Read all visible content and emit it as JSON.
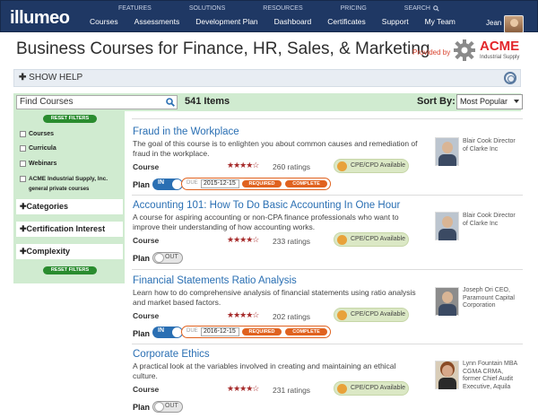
{
  "brand": {
    "logo": "illumeo",
    "accent": "#1f3864"
  },
  "utility_nav": [
    "FEATURES",
    "SOLUTIONS",
    "RESOURCES",
    "PRICING",
    "SEARCH"
  ],
  "main_nav": [
    "Courses",
    "Assessments",
    "Development Plan",
    "Dashboard",
    "Certificates",
    "Support",
    "My Team"
  ],
  "user": {
    "name": "Jean"
  },
  "page": {
    "title": "Business Courses for Finance, HR, Sales, & Marketing",
    "provided_by": "Provided by",
    "provider_name": "ACME",
    "provider_sub": "Industrial Supply"
  },
  "help": {
    "label": "SHOW HELP"
  },
  "search": {
    "value": "Find Courses",
    "count": "541 Items"
  },
  "sort": {
    "label": "Sort By:",
    "selected": "Most Popular"
  },
  "sidebar": {
    "reset_label": "RESET FILTERS",
    "checks": [
      "Courses",
      "Curricula",
      "Webinars",
      "ACME Industrial Supply, Inc."
    ],
    "acme_sub": "general private courses",
    "accordions": [
      "Categories",
      "Certification Interest",
      "Complexity"
    ]
  },
  "courses": [
    {
      "title": "Fraud in the Workplace",
      "desc": "The goal of this course is to enlighten you about common causes and remediation of fraud in the workplace.",
      "type": "Course",
      "stars": "★★★★☆",
      "ratings": "260 ratings",
      "cpe": "CPE/CPD Available",
      "plan": "Plan",
      "plan_state": "IN",
      "due_label": "DUE",
      "due_date": "2015-12-15",
      "required": "REQUIRED",
      "complete": "COMPLETE",
      "author": "Blair Cook Director of Clarke Inc"
    },
    {
      "title": "Accounting 101: How To Do Basic Accounting In One Hour",
      "desc": "A course for aspiring accounting or non-CPA finance professionals who want to improve their understanding of how accounting works.",
      "type": "Course",
      "stars": "★★★★☆",
      "ratings": "233 ratings",
      "cpe": "CPE/CPD Available",
      "plan": "Plan",
      "plan_state": "OUT",
      "author": "Blair Cook Director of Clarke Inc"
    },
    {
      "title": "Financial Statements Ratio Analysis",
      "desc": "Learn how to do comprehensive analysis of financial statements using ratio analysis and market based factors.",
      "type": "Course",
      "stars": "★★★★☆",
      "ratings": "202 ratings",
      "cpe": "CPE/CPD Available",
      "plan": "Plan",
      "plan_state": "IN",
      "due_label": "DUE",
      "due_date": "2016-12-15",
      "required": "REQUIRED",
      "complete": "COMPLETE",
      "author": "Joseph Ori CEO, Paramount Capital Corporation"
    },
    {
      "title": "Corporate Ethics",
      "desc": "A practical look at the variables involved in creating and maintaining an ethical culture.",
      "type": "Course",
      "stars": "★★★★☆",
      "ratings": "231 ratings",
      "cpe": "CPE/CPD Available",
      "plan": "Plan",
      "plan_state": "OUT",
      "author": "Lynn Fountain MBA CGMA CRMA, former Chief Audit Executive, Aquila"
    }
  ]
}
